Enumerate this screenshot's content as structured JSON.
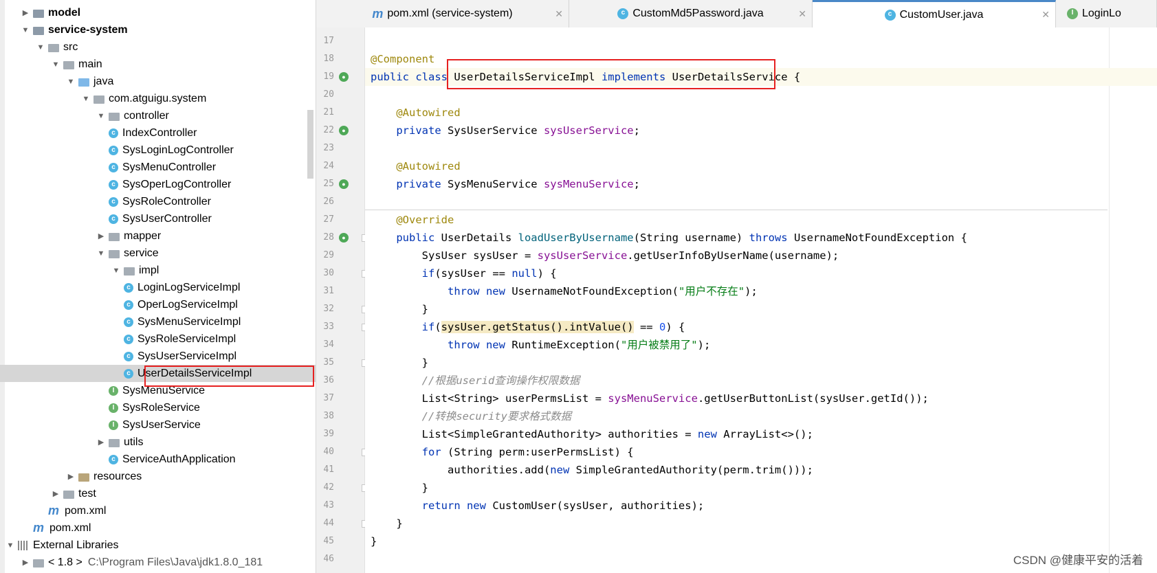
{
  "project_tree": {
    "items": [
      {
        "label": "model",
        "arrow": "▶",
        "icon": "module-folder-icon",
        "bold": true
      },
      {
        "label": "service-system",
        "arrow": "▼",
        "icon": "module-folder-icon",
        "bold": true
      },
      {
        "label": "src",
        "arrow": "▼",
        "icon": "folder-icon"
      },
      {
        "label": "main",
        "arrow": "▼",
        "icon": "folder-icon"
      },
      {
        "label": "java",
        "arrow": "▼",
        "icon": "source-folder-icon"
      },
      {
        "label": "com.atguigu.system",
        "arrow": "▼",
        "icon": "package-icon"
      },
      {
        "label": "controller",
        "arrow": "▼",
        "icon": "package-icon"
      },
      {
        "label": "IndexController",
        "arrow": "",
        "icon": "class-icon"
      },
      {
        "label": "SysLoginLogController",
        "arrow": "",
        "icon": "class-icon"
      },
      {
        "label": "SysMenuController",
        "arrow": "",
        "icon": "class-icon"
      },
      {
        "label": "SysOperLogController",
        "arrow": "",
        "icon": "class-icon"
      },
      {
        "label": "SysRoleController",
        "arrow": "",
        "icon": "class-icon"
      },
      {
        "label": "SysUserController",
        "arrow": "",
        "icon": "class-icon"
      },
      {
        "label": "mapper",
        "arrow": "▶",
        "icon": "package-icon"
      },
      {
        "label": "service",
        "arrow": "▼",
        "icon": "package-icon"
      },
      {
        "label": "impl",
        "arrow": "▼",
        "icon": "package-icon"
      },
      {
        "label": "LoginLogServiceImpl",
        "arrow": "",
        "icon": "class-icon"
      },
      {
        "label": "OperLogServiceImpl",
        "arrow": "",
        "icon": "class-icon"
      },
      {
        "label": "SysMenuServiceImpl",
        "arrow": "",
        "icon": "class-icon"
      },
      {
        "label": "SysRoleServiceImpl",
        "arrow": "",
        "icon": "class-icon"
      },
      {
        "label": "SysUserServiceImpl",
        "arrow": "",
        "icon": "class-icon"
      },
      {
        "label": "UserDetailsServiceImpl",
        "arrow": "",
        "icon": "class-icon",
        "selected": true
      },
      {
        "label": "SysMenuService",
        "arrow": "",
        "icon": "interface-icon"
      },
      {
        "label": "SysRoleService",
        "arrow": "",
        "icon": "interface-icon"
      },
      {
        "label": "SysUserService",
        "arrow": "",
        "icon": "interface-icon"
      },
      {
        "label": "utils",
        "arrow": "▶",
        "icon": "package-icon"
      },
      {
        "label": "ServiceAuthApplication",
        "arrow": "",
        "icon": "spring-class-icon"
      },
      {
        "label": "resources",
        "arrow": "▶",
        "icon": "resources-folder-icon"
      },
      {
        "label": "test",
        "arrow": "▶",
        "icon": "folder-icon"
      },
      {
        "label": "pom.xml",
        "arrow": "",
        "icon": "maven-icon"
      },
      {
        "label": "pom.xml",
        "arrow": "",
        "icon": "maven-icon"
      },
      {
        "label": "External Libraries",
        "arrow": "▼",
        "icon": "libraries-icon"
      },
      {
        "label": "< 1.8 >",
        "suffix": "C:\\Program Files\\Java\\jdk1.8.0_181",
        "arrow": "▶",
        "icon": "jdk-icon"
      }
    ]
  },
  "tabs": [
    {
      "label": "pom.xml (service-system)",
      "icon": "maven-icon",
      "close": "✕"
    },
    {
      "label": "CustomMd5Password.java",
      "icon": "class-icon",
      "close": "✕"
    },
    {
      "label": "CustomUser.java",
      "icon": "class-icon",
      "close": "✕",
      "active": true
    },
    {
      "label": "LoginLo",
      "icon": "interface-icon",
      "close": ""
    }
  ],
  "editor": {
    "line_numbers": [
      "17",
      "18",
      "19",
      "20",
      "21",
      "22",
      "23",
      "24",
      "25",
      "26",
      "27",
      "28",
      "29",
      "30",
      "31",
      "32",
      "33",
      "34",
      "35",
      "36",
      "37",
      "38",
      "39",
      "40",
      "41",
      "42",
      "43",
      "44",
      "45",
      "46"
    ],
    "lines": [
      [],
      [
        {
          "t": "@Component",
          "c": "an"
        }
      ],
      [
        {
          "t": "public class ",
          "c": "kw"
        },
        {
          "t": "UserDetailsServiceImpl "
        },
        {
          "t": "implements ",
          "c": "kw"
        },
        {
          "t": "UserDetailsService {"
        }
      ],
      [],
      [
        {
          "t": "    "
        },
        {
          "t": "@Autowired",
          "c": "an"
        }
      ],
      [
        {
          "t": "    "
        },
        {
          "t": "private ",
          "c": "kw"
        },
        {
          "t": "SysUserService "
        },
        {
          "t": "sysUserService",
          "c": "fld"
        },
        {
          "t": ";"
        }
      ],
      [],
      [
        {
          "t": "    "
        },
        {
          "t": "@Autowired",
          "c": "an"
        }
      ],
      [
        {
          "t": "    "
        },
        {
          "t": "private ",
          "c": "kw"
        },
        {
          "t": "SysMenuService "
        },
        {
          "t": "sysMenuService",
          "c": "fld"
        },
        {
          "t": ";"
        }
      ],
      [],
      [
        {
          "t": "    "
        },
        {
          "t": "@Override",
          "c": "an"
        }
      ],
      [
        {
          "t": "    "
        },
        {
          "t": "public ",
          "c": "kw"
        },
        {
          "t": "UserDetails "
        },
        {
          "t": "loadUserByUsername",
          "c": "mt"
        },
        {
          "t": "(String username) "
        },
        {
          "t": "throws ",
          "c": "kw"
        },
        {
          "t": "UsernameNotFoundException {"
        }
      ],
      [
        {
          "t": "        SysUser sysUser = "
        },
        {
          "t": "sysUserService",
          "c": "fld"
        },
        {
          "t": ".getUserInfoByUserName(username);"
        }
      ],
      [
        {
          "t": "        "
        },
        {
          "t": "if",
          "c": "kw"
        },
        {
          "t": "(sysUser == "
        },
        {
          "t": "null",
          "c": "kw"
        },
        {
          "t": ") {"
        }
      ],
      [
        {
          "t": "            "
        },
        {
          "t": "throw new ",
          "c": "kw"
        },
        {
          "t": "UsernameNotFoundException("
        },
        {
          "t": "\"用户不存在\"",
          "c": "str"
        },
        {
          "t": ");"
        }
      ],
      [
        {
          "t": "        }"
        }
      ],
      [
        {
          "t": "        "
        },
        {
          "t": "if",
          "c": "kw"
        },
        {
          "t": "("
        },
        {
          "t": "sysUser.getStatus().intValue()",
          "c": "warnbg"
        },
        {
          "t": " == "
        },
        {
          "t": "0",
          "c": "num"
        },
        {
          "t": ") {"
        }
      ],
      [
        {
          "t": "            "
        },
        {
          "t": "throw new ",
          "c": "kw"
        },
        {
          "t": "RuntimeException("
        },
        {
          "t": "\"用户被禁用了\"",
          "c": "str"
        },
        {
          "t": ");"
        }
      ],
      [
        {
          "t": "        }"
        }
      ],
      [
        {
          "t": "        "
        },
        {
          "t": "//根据userid查询操作权限数据",
          "c": "cm"
        }
      ],
      [
        {
          "t": "        List<String> userPermsList = "
        },
        {
          "t": "sysMenuService",
          "c": "fld"
        },
        {
          "t": ".getUserButtonList(sysUser.getId());"
        }
      ],
      [
        {
          "t": "        "
        },
        {
          "t": "//转换security要求格式数据",
          "c": "cm"
        }
      ],
      [
        {
          "t": "        List<SimpleGrantedAuthority> authorities = "
        },
        {
          "t": "new ",
          "c": "kw"
        },
        {
          "t": "ArrayList<>();"
        }
      ],
      [
        {
          "t": "        "
        },
        {
          "t": "for ",
          "c": "kw"
        },
        {
          "t": "(String perm:userPermsList) {"
        }
      ],
      [
        {
          "t": "            authorities.add("
        },
        {
          "t": "new ",
          "c": "kw"
        },
        {
          "t": "SimpleGrantedAuthority(perm.trim()));"
        }
      ],
      [
        {
          "t": "        }"
        }
      ],
      [
        {
          "t": "        "
        },
        {
          "t": "return new ",
          "c": "kw"
        },
        {
          "t": "CustomUser(sysUser, authorities);"
        }
      ],
      [
        {
          "t": "    }"
        }
      ],
      [
        {
          "t": "}"
        }
      ],
      []
    ]
  },
  "colors": {
    "accent": "#4a88c7",
    "highlight_box": "#e62020",
    "keyword": "#0033b3",
    "annotation": "#9e880d",
    "field": "#871094",
    "string": "#067d17",
    "comment": "#8c8c8c"
  },
  "watermark": "CSDN @健康平安的活着"
}
